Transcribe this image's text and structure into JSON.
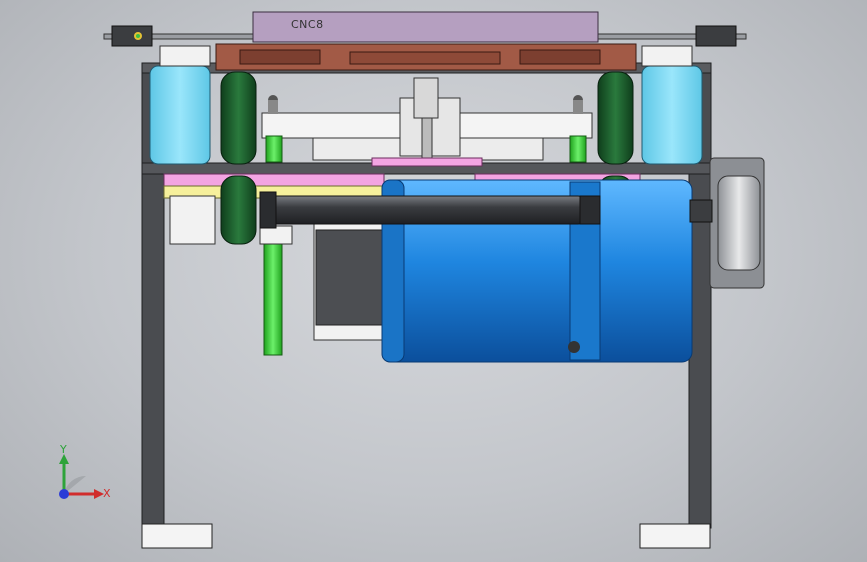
{
  "model": {
    "part_label": "CNC8"
  },
  "triad": {
    "x_label": "X",
    "y_label": "Y"
  },
  "colors": {
    "background": "#c3c6cb",
    "frame": "#4a4c50",
    "top_plate": "#b59fc0",
    "mount_plate": "#a25a46",
    "cyan_block": "#7fd9f2",
    "wheel": "#1d5e2e",
    "motor": "#1f86e0",
    "green_rod": "#3ccf3a",
    "pink_strip": "#f3a4e2",
    "yellow_strip": "#f6f09c"
  }
}
